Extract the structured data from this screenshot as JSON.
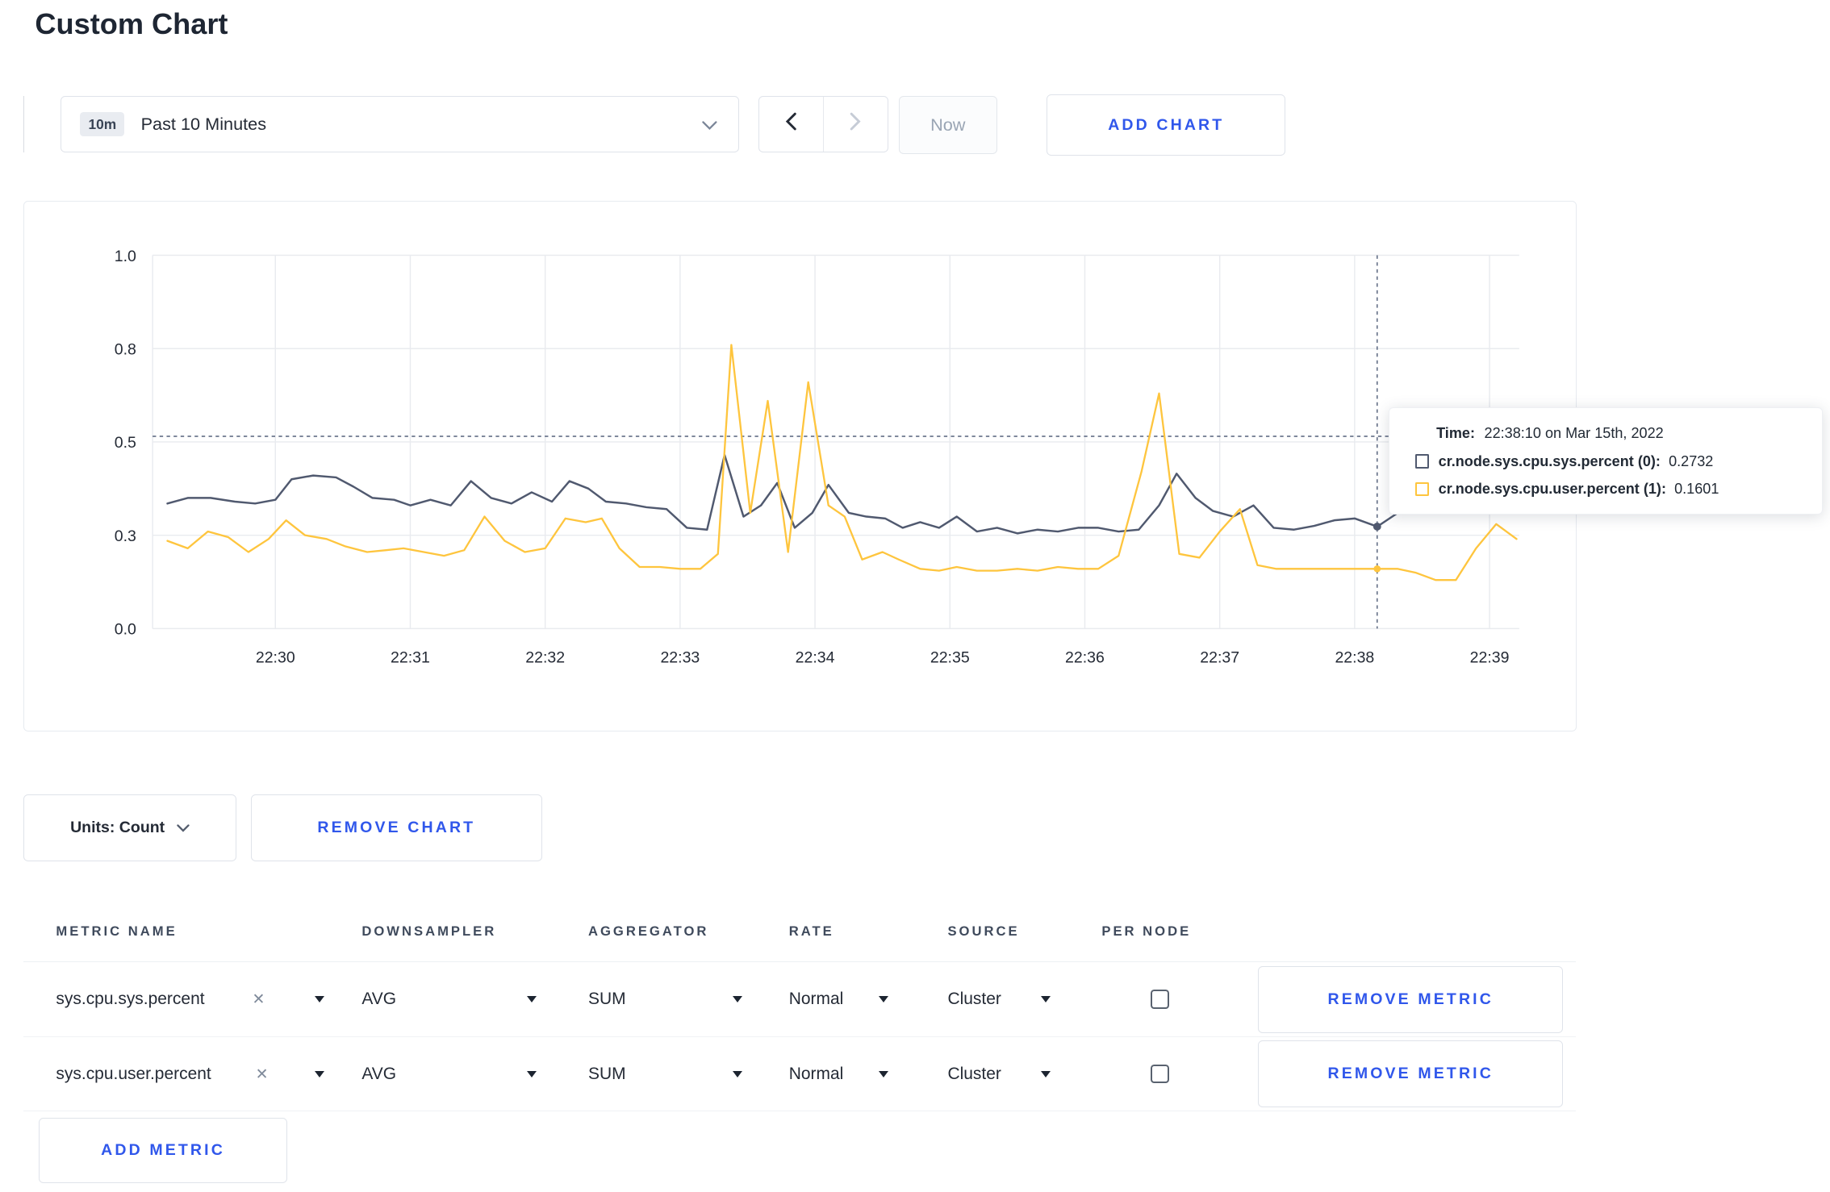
{
  "page": {
    "title": "Custom Chart"
  },
  "icons": {
    "close": "✕"
  },
  "toolbar": {
    "range_badge": "10m",
    "range_label": "Past 10 Minutes",
    "now_label": "Now",
    "add_chart_label": "ADD CHART"
  },
  "chart": {
    "tooltip": {
      "time_label": "Time:",
      "time_value": "22:38:10 on Mar 15th, 2022",
      "series": [
        {
          "name": "cr.node.sys.cpu.sys.percent (0):",
          "value": "0.2732",
          "color": "#50596f"
        },
        {
          "name": "cr.node.sys.cpu.user.percent (1):",
          "value": "0.1601",
          "color": "#fec53e"
        }
      ]
    }
  },
  "chart_data": {
    "type": "line",
    "title": "Custom Chart",
    "xlabel": "",
    "ylabel": "",
    "legend": "none",
    "grid": true,
    "x_domain": [
      0.09,
      10.22
    ],
    "y_domain": [
      0,
      1
    ],
    "x_ticks": {
      "positions": [
        1,
        2,
        3,
        4,
        5,
        6,
        7,
        8,
        9,
        10
      ],
      "labels": [
        "22:30",
        "22:31",
        "22:32",
        "22:33",
        "22:34",
        "22:35",
        "22:36",
        "22:37",
        "22:38",
        "22:39"
      ]
    },
    "y_ticks": {
      "positions": [
        0,
        0.25,
        0.5,
        0.75,
        1
      ],
      "labels": [
        "0.0",
        "0.3",
        "0.5",
        "0.8",
        "1.0"
      ]
    },
    "grid_color": "#e9ebef",
    "crosshair": {
      "x": 9.167,
      "y": 0.515,
      "color": "#55617b",
      "time": "22:38:10 on Mar 15th, 2022"
    },
    "series": [
      {
        "name": "cr.node.sys.cpu.sys.percent",
        "color": "#50596f",
        "width": 1.7,
        "marker": [
          9.167,
          0.2732
        ],
        "marker_r": 3.4,
        "points": [
          [
            0.2,
            0.335
          ],
          [
            0.35,
            0.35
          ],
          [
            0.52,
            0.35
          ],
          [
            0.7,
            0.34
          ],
          [
            0.85,
            0.335
          ],
          [
            1.0,
            0.345
          ],
          [
            1.12,
            0.4
          ],
          [
            1.28,
            0.41
          ],
          [
            1.45,
            0.405
          ],
          [
            1.58,
            0.38
          ],
          [
            1.72,
            0.35
          ],
          [
            1.88,
            0.345
          ],
          [
            2.0,
            0.33
          ],
          [
            2.15,
            0.345
          ],
          [
            2.3,
            0.33
          ],
          [
            2.45,
            0.395
          ],
          [
            2.6,
            0.35
          ],
          [
            2.75,
            0.335
          ],
          [
            2.9,
            0.365
          ],
          [
            3.05,
            0.34
          ],
          [
            3.18,
            0.395
          ],
          [
            3.32,
            0.375
          ],
          [
            3.45,
            0.34
          ],
          [
            3.6,
            0.335
          ],
          [
            3.75,
            0.325
          ],
          [
            3.9,
            0.32
          ],
          [
            4.05,
            0.27
          ],
          [
            4.2,
            0.265
          ],
          [
            4.33,
            0.465
          ],
          [
            4.47,
            0.3
          ],
          [
            4.6,
            0.33
          ],
          [
            4.72,
            0.39
          ],
          [
            4.85,
            0.27
          ],
          [
            4.98,
            0.31
          ],
          [
            5.1,
            0.385
          ],
          [
            5.25,
            0.31
          ],
          [
            5.38,
            0.3
          ],
          [
            5.52,
            0.295
          ],
          [
            5.65,
            0.27
          ],
          [
            5.78,
            0.285
          ],
          [
            5.92,
            0.27
          ],
          [
            6.05,
            0.3
          ],
          [
            6.2,
            0.26
          ],
          [
            6.35,
            0.27
          ],
          [
            6.5,
            0.255
          ],
          [
            6.65,
            0.265
          ],
          [
            6.8,
            0.26
          ],
          [
            6.95,
            0.27
          ],
          [
            7.1,
            0.27
          ],
          [
            7.25,
            0.26
          ],
          [
            7.4,
            0.265
          ],
          [
            7.55,
            0.33
          ],
          [
            7.68,
            0.415
          ],
          [
            7.82,
            0.35
          ],
          [
            7.95,
            0.315
          ],
          [
            8.1,
            0.3
          ],
          [
            8.25,
            0.33
          ],
          [
            8.4,
            0.27
          ],
          [
            8.55,
            0.265
          ],
          [
            8.7,
            0.275
          ],
          [
            8.85,
            0.29
          ],
          [
            9.0,
            0.295
          ],
          [
            9.167,
            0.2732
          ],
          [
            9.32,
            0.31
          ]
        ]
      },
      {
        "name": "cr.node.sys.cpu.user.percent",
        "color": "#fec53e",
        "width": 1.6,
        "marker": [
          9.167,
          0.1601
        ],
        "marker_r": 3.0,
        "points": [
          [
            0.2,
            0.235
          ],
          [
            0.35,
            0.215
          ],
          [
            0.5,
            0.26
          ],
          [
            0.65,
            0.245
          ],
          [
            0.8,
            0.205
          ],
          [
            0.95,
            0.24
          ],
          [
            1.08,
            0.29
          ],
          [
            1.22,
            0.25
          ],
          [
            1.38,
            0.24
          ],
          [
            1.52,
            0.22
          ],
          [
            1.68,
            0.205
          ],
          [
            1.82,
            0.21
          ],
          [
            1.95,
            0.215
          ],
          [
            2.1,
            0.205
          ],
          [
            2.25,
            0.195
          ],
          [
            2.4,
            0.21
          ],
          [
            2.55,
            0.3
          ],
          [
            2.7,
            0.235
          ],
          [
            2.85,
            0.205
          ],
          [
            3.0,
            0.215
          ],
          [
            3.15,
            0.295
          ],
          [
            3.3,
            0.285
          ],
          [
            3.42,
            0.295
          ],
          [
            3.55,
            0.215
          ],
          [
            3.7,
            0.165
          ],
          [
            3.85,
            0.165
          ],
          [
            4.0,
            0.16
          ],
          [
            4.15,
            0.16
          ],
          [
            4.28,
            0.2
          ],
          [
            4.38,
            0.76
          ],
          [
            4.52,
            0.31
          ],
          [
            4.65,
            0.61
          ],
          [
            4.8,
            0.205
          ],
          [
            4.95,
            0.66
          ],
          [
            5.1,
            0.33
          ],
          [
            5.22,
            0.3
          ],
          [
            5.35,
            0.185
          ],
          [
            5.5,
            0.205
          ],
          [
            5.62,
            0.185
          ],
          [
            5.78,
            0.16
          ],
          [
            5.92,
            0.155
          ],
          [
            6.05,
            0.165
          ],
          [
            6.2,
            0.155
          ],
          [
            6.35,
            0.155
          ],
          [
            6.5,
            0.16
          ],
          [
            6.65,
            0.155
          ],
          [
            6.8,
            0.165
          ],
          [
            6.95,
            0.16
          ],
          [
            7.1,
            0.16
          ],
          [
            7.25,
            0.195
          ],
          [
            7.42,
            0.42
          ],
          [
            7.55,
            0.63
          ],
          [
            7.7,
            0.2
          ],
          [
            7.85,
            0.19
          ],
          [
            8.0,
            0.26
          ],
          [
            8.15,
            0.32
          ],
          [
            8.28,
            0.17
          ],
          [
            8.42,
            0.16
          ],
          [
            8.55,
            0.16
          ],
          [
            8.7,
            0.16
          ],
          [
            8.85,
            0.16
          ],
          [
            9.0,
            0.16
          ],
          [
            9.167,
            0.1601
          ],
          [
            9.32,
            0.16
          ],
          [
            9.45,
            0.15
          ],
          [
            9.6,
            0.13
          ],
          [
            9.75,
            0.13
          ],
          [
            9.9,
            0.215
          ],
          [
            10.05,
            0.28
          ],
          [
            10.2,
            0.24
          ]
        ]
      }
    ]
  },
  "controls": {
    "units_label": "Units: Count",
    "remove_chart_label": "REMOVE CHART",
    "add_metric_label": "ADD METRIC"
  },
  "table": {
    "headers": [
      "METRIC NAME",
      "DOWNSAMPLER",
      "AGGREGATOR",
      "RATE",
      "SOURCE",
      "PER NODE"
    ],
    "rows": [
      {
        "metric": "sys.cpu.sys.percent",
        "downsampler": "AVG",
        "aggregator": "SUM",
        "rate": "Normal",
        "source": "Cluster",
        "per_node": false,
        "remove_label": "REMOVE METRIC"
      },
      {
        "metric": "sys.cpu.user.percent",
        "downsampler": "AVG",
        "aggregator": "SUM",
        "rate": "Normal",
        "source": "Cluster",
        "per_node": false,
        "remove_label": "REMOVE METRIC"
      }
    ]
  }
}
